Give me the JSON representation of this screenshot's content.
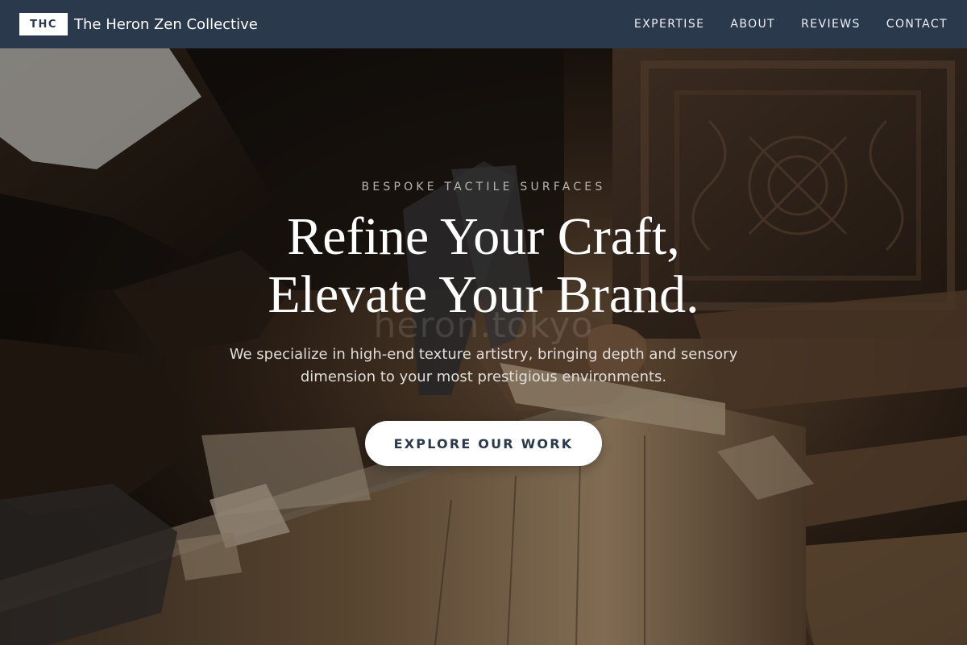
{
  "site": {
    "logo_mark": "THC",
    "name": "The Heron Zen Collective"
  },
  "nav": {
    "items": [
      {
        "label": "EXPERTISE"
      },
      {
        "label": "ABOUT"
      },
      {
        "label": "REVIEWS"
      },
      {
        "label": "CONTACT"
      }
    ]
  },
  "hero": {
    "eyebrow": "BESPOKE TACTILE SURFACES",
    "title_line1": "Refine Your Craft,",
    "title_line2": "Elevate Your Brand.",
    "watermark": "heron.tokyo",
    "subtitle": "We specialize in high-end texture artistry, bringing depth and sensory dimension to your most prestigious environments.",
    "cta_label": "EXPLORE OUR WORK",
    "background_image": "woodworker-carving-photo"
  },
  "colors": {
    "nav_background": "#2a394c",
    "accent_dark": "#2a394c",
    "cta_background": "#ffffff",
    "text_light": "#ffffff"
  }
}
